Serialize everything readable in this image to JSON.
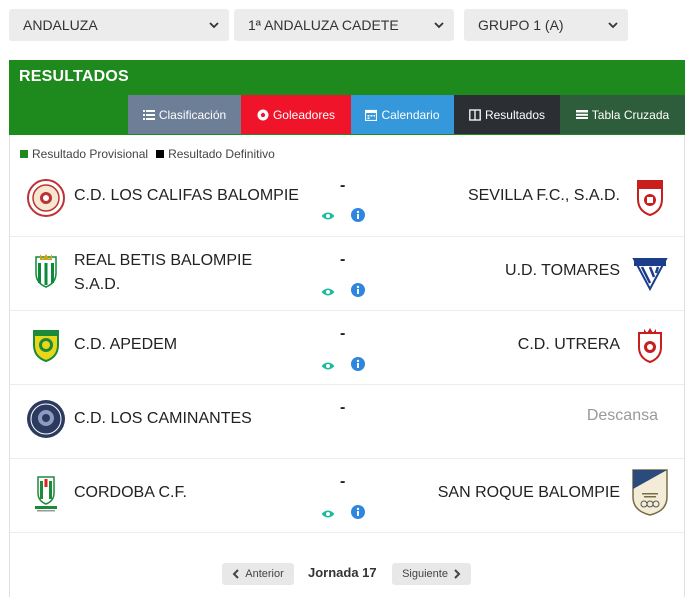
{
  "filters": {
    "region": "ANDALUZA",
    "competition": "1ª ANDALUZA CADETE",
    "group": "GRUPO 1 (A)"
  },
  "panel": {
    "title": "RESULTADOS",
    "tabs": [
      {
        "label": "Clasificación",
        "icon": "list-icon"
      },
      {
        "label": "Goleadores",
        "icon": "soccer-ball-icon"
      },
      {
        "label": "Calendario",
        "icon": "calendar-icon"
      },
      {
        "label": "Resultados",
        "icon": "columns-icon"
      },
      {
        "label": "Tabla Cruzada",
        "icon": "table-icon"
      }
    ],
    "legend": {
      "provisional": "Resultado Provisional",
      "definitivo": "Resultado Definitivo",
      "provisional_color": "#1e8a1e",
      "definitivo_color": "#000000"
    }
  },
  "matches": [
    {
      "home": "C.D. LOS CALIFAS BALOMPIE",
      "score": "-",
      "away": "SEVILLA F.C., S.A.D."
    },
    {
      "home": "REAL BETIS BALOMPIE S.A.D.",
      "score": "-",
      "away": "U.D. TOMARES"
    },
    {
      "home": "C.D. APEDEM",
      "score": "-",
      "away": "C.D. UTRERA"
    },
    {
      "home": "C.D. LOS CAMINANTES",
      "score": "-",
      "away": "Descansa"
    },
    {
      "home": "CORDOBA C.F.",
      "score": "-",
      "away": "SAN ROQUE BALOMPIE"
    }
  ],
  "pagination": {
    "prev": "Anterior",
    "current": "Jornada 17",
    "next": "Siguiente"
  },
  "colors": {
    "header_green": "#1e8a1e",
    "eye_icon": "#1abc9c",
    "info_icon": "#2e86de"
  }
}
